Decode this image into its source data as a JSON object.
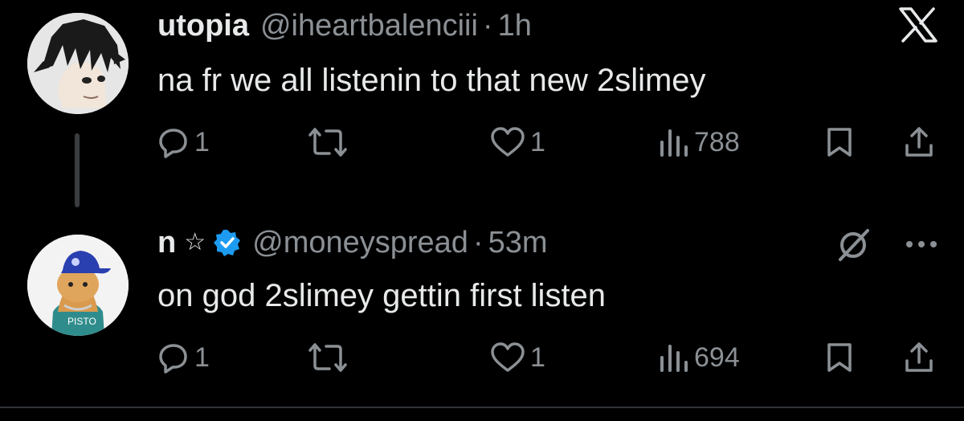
{
  "app": {
    "logo_icon": "x-logo-icon"
  },
  "tweets": [
    {
      "name": "utopia",
      "handle": "@iheartbalenciii",
      "separator": "·",
      "time": "1h",
      "text": "na fr we all listenin to that new 2slimey",
      "replies": "1",
      "retweets": "",
      "likes": "1",
      "views": "788",
      "avatar_icon": "anime-character-avatar"
    },
    {
      "name": "n",
      "name_symbol": "☆",
      "verified": true,
      "handle": "@moneyspread",
      "separator": "·",
      "time": "53m",
      "text": "on god 2slimey gettin first listen",
      "replies": "1",
      "retweets": "",
      "likes": "1",
      "views": "694",
      "avatar_icon": "cat-avatar"
    }
  ],
  "colors": {
    "background": "#000000",
    "text": "#e7e9ea",
    "muted": "#8b9095",
    "verified": "#1d9bf0"
  }
}
